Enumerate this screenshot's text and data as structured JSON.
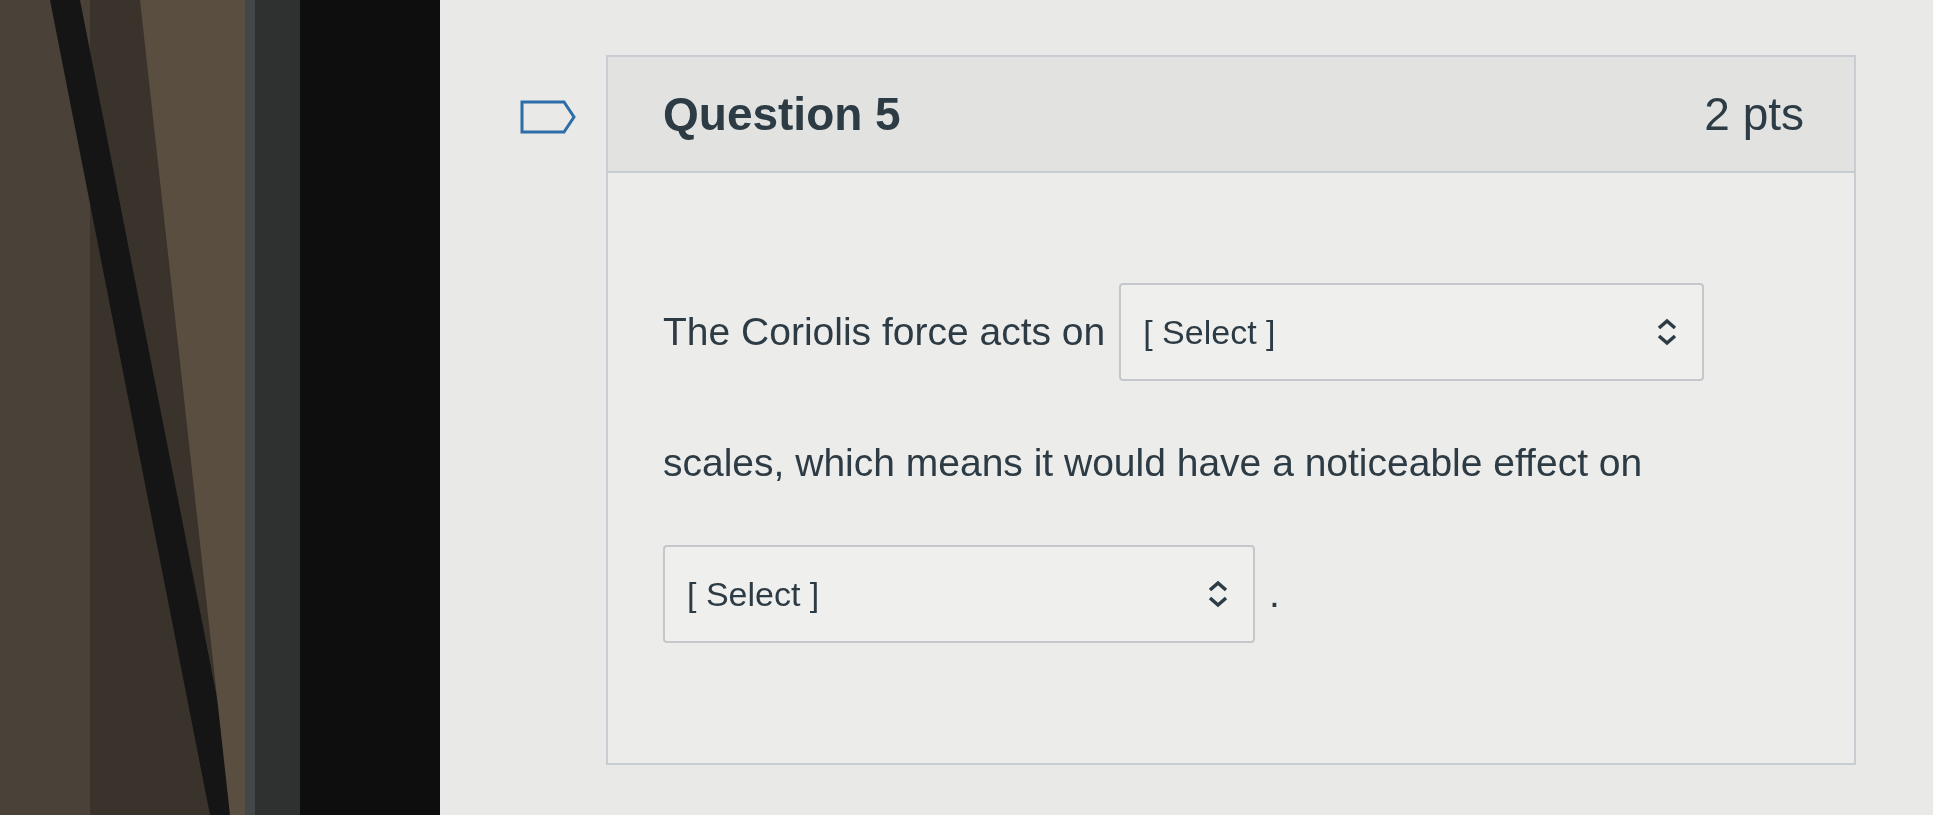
{
  "question": {
    "title": "Question 5",
    "points": "2 pts",
    "body": [
      {
        "kind": "text",
        "text": "The Coriolis force acts on"
      },
      {
        "kind": "select",
        "value": "[ Select ]"
      },
      {
        "kind": "break"
      },
      {
        "kind": "text",
        "text": "scales, which means it would have a noticeable effect on"
      },
      {
        "kind": "break"
      },
      {
        "kind": "select",
        "value": "[ Select ]"
      },
      {
        "kind": "text",
        "text": "."
      }
    ]
  }
}
